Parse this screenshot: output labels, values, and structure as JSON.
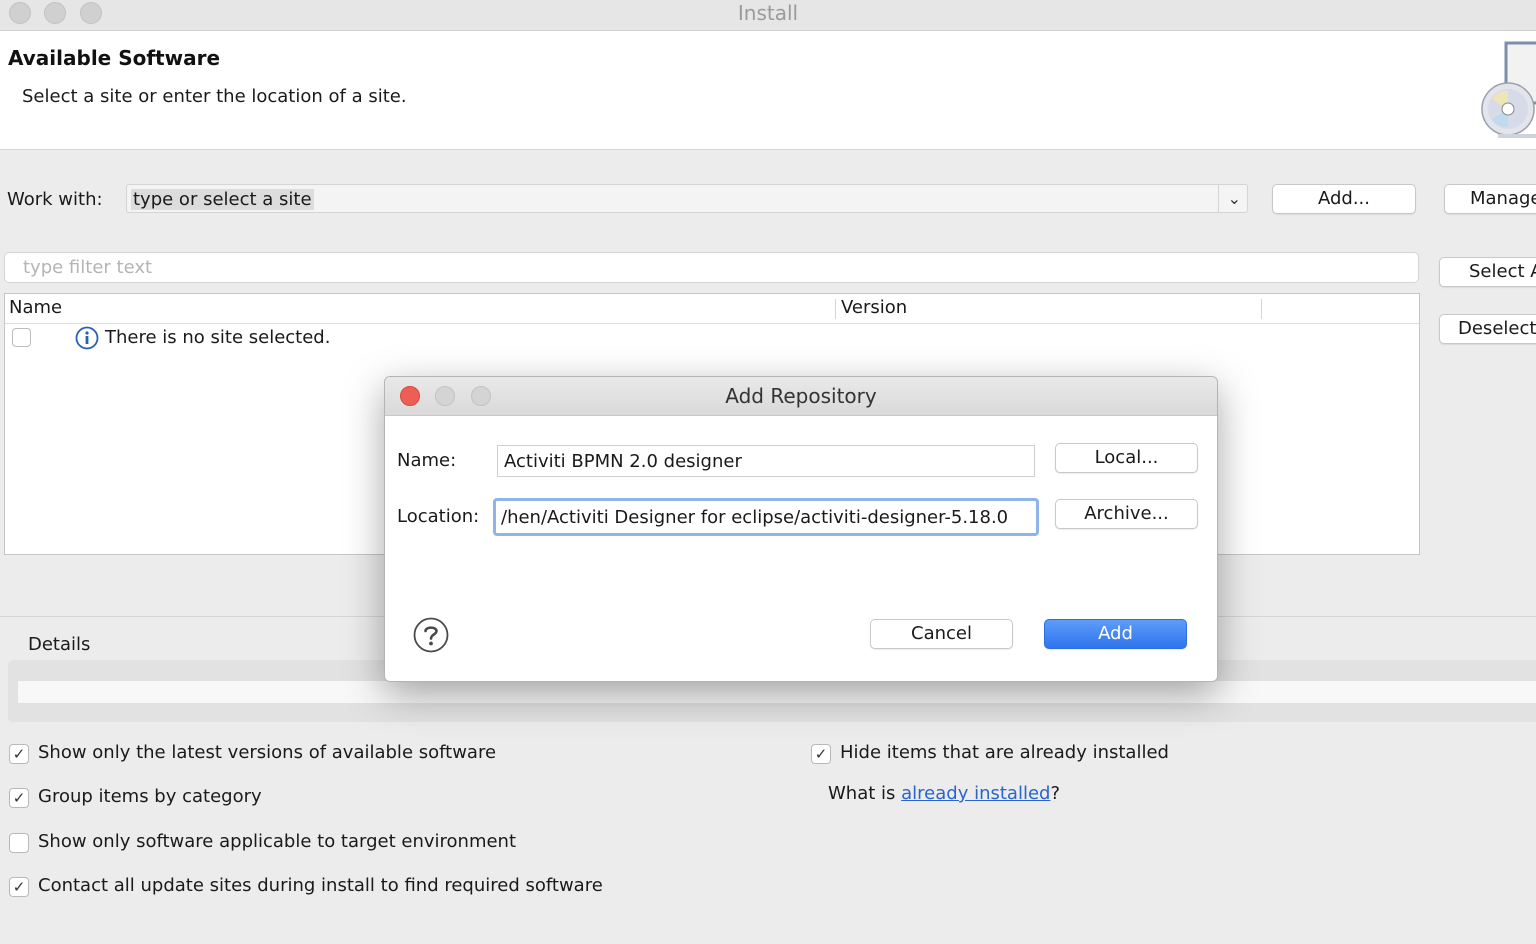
{
  "window": {
    "title": "Install"
  },
  "header": {
    "title": "Available Software",
    "subtitle": "Select a site or enter the location of a site."
  },
  "work_with": {
    "label": "Work with:",
    "value": "type or select a site",
    "add_label": "Add...",
    "manage_label": "Manage"
  },
  "filter": {
    "placeholder": "type filter text"
  },
  "side_buttons": {
    "select_all": "Select A",
    "deselect_all": "Deselect"
  },
  "table": {
    "columns": [
      "Name",
      "Version"
    ],
    "empty_message": "There is no site selected."
  },
  "details": {
    "label": "Details"
  },
  "options": {
    "latest_versions": {
      "label": "Show only the latest versions of available software",
      "checked": true
    },
    "group_by_category": {
      "label": "Group items by category",
      "checked": true
    },
    "target_env": {
      "label": "Show only software applicable to target environment",
      "checked": false
    },
    "contact_sites": {
      "label": "Contact all update sites during install to find required software",
      "checked": true
    },
    "hide_installed": {
      "label": "Hide items that are already installed",
      "checked": true
    },
    "what_is_prefix": "What is ",
    "already_installed_link": "already installed",
    "what_is_suffix": "?"
  },
  "dialog": {
    "title": "Add Repository",
    "name_label": "Name:",
    "name_value": "Activiti BPMN 2.0 designer",
    "location_label": "Location:",
    "location_value": "hen/Activiti Designer for eclipse/activiti-designer-5.18.0/",
    "local_label": "Local...",
    "archive_label": "Archive...",
    "cancel_label": "Cancel",
    "add_label": "Add"
  },
  "colors": {
    "accent": "#2f74ee",
    "link": "#2965cc",
    "close_red": "#ec5f57",
    "focus_ring": "#8fb4ec"
  }
}
